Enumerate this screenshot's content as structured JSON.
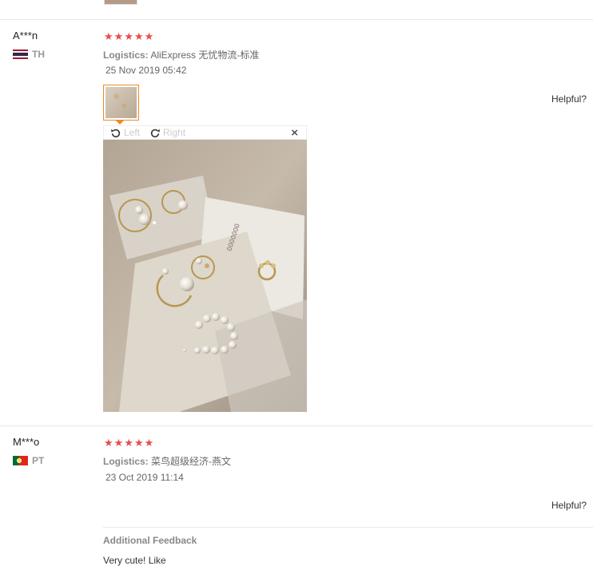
{
  "reviews": [
    {
      "user": "A***n",
      "country_code": "TH",
      "rating": 5,
      "stars": [
        "★",
        "★",
        "★",
        "★",
        "★"
      ],
      "logistics_label": "Logistics:",
      "logistics_value": "AliExpress 无忧物流-标准",
      "date": "25 Nov 2019 05:42",
      "helpful_label": "Helpful?",
      "viewer": {
        "rotate_left_label": "Left",
        "rotate_right_label": "Right",
        "close_symbol": "×"
      }
    },
    {
      "user": "M***o",
      "country_code": "PT",
      "rating": 5,
      "stars": [
        "★",
        "★",
        "★",
        "★",
        "★"
      ],
      "logistics_label": "Logistics:",
      "logistics_value": "菜鸟超级经济-燕文",
      "date": "23 Oct 2019 11:14",
      "helpful_label": "Helpful?",
      "additional_feedback_title": "Additional Feedback",
      "additional_feedback_text": "Very cute! Like"
    }
  ],
  "colors": {
    "star": "#e84c4c",
    "thumb_border_active": "#f08a24",
    "separator": "#e8e8e8"
  },
  "icons": {
    "rotate_left": "rotate-left-icon",
    "rotate_right": "rotate-right-icon",
    "close": "close-icon",
    "flag_th": "flag-thailand-icon",
    "flag_pt": "flag-portugal-icon"
  }
}
